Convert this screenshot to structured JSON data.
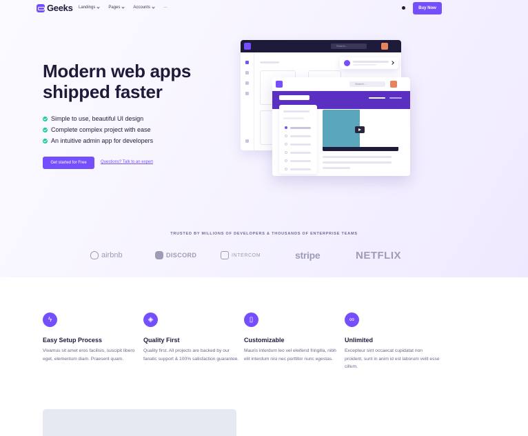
{
  "brand": {
    "name": "Geeks",
    "accent": "#754ffe"
  },
  "nav": {
    "items": [
      {
        "label": "Landings"
      },
      {
        "label": "Pages"
      },
      {
        "label": "Accounts"
      },
      {
        "label": "···"
      }
    ],
    "buy_label": "Buy Now"
  },
  "hero": {
    "title": "Modern web apps shipped faster",
    "features": [
      "Simple to use, beautiful UI design",
      "Complete complex project with ease",
      "An intuitive admin app for developers"
    ],
    "cta_label": "Get started for Free",
    "link_label": "Questions? Talk to an expert"
  },
  "mockup": {
    "search_placeholder": "Search..."
  },
  "trusted": {
    "heading": "TRUSTED BY MILLIONS OF DEVELOPERS & THOUSANDS OF ENTERPRISE TEAMS",
    "logos": [
      "airbnb",
      "DISCORD",
      "INTERCOM",
      "stripe",
      "NETFLIX"
    ]
  },
  "features": [
    {
      "icon": "lightning-icon",
      "glyph": "ϟ",
      "title": "Easy Setup Process",
      "desc": "Vivamus sit amet eros facilisis, suscipit libero eget, elementum diam. Praesent quam."
    },
    {
      "icon": "layers-icon",
      "glyph": "◈",
      "title": "Quality First",
      "desc": "Quality first. All projects are backed by our fanatic support & 100% satisfaction guarantee."
    },
    {
      "icon": "phone-icon",
      "glyph": "▯",
      "title": "Customizable",
      "desc": "Mauris interdum leo vel eleifend fringilla, nibh elit interdum nisi nec porttitor nunc egestas."
    },
    {
      "icon": "infinity-icon",
      "glyph": "∞",
      "title": "Unlimited",
      "desc": "Excepteur sint occaecat cupidatat non proident, sunt in anim id est laborum velit esse cillum."
    }
  ]
}
